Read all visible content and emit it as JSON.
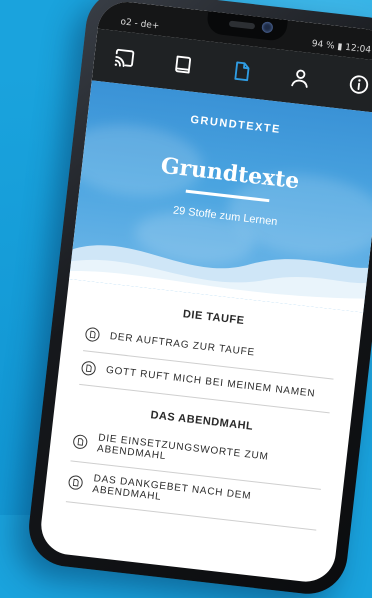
{
  "status_bar": {
    "carrier": "o2 - de+",
    "battery": "94 %",
    "time": "12:04"
  },
  "nav": {
    "items": [
      "cast-icon",
      "book-icon",
      "document-icon",
      "person-icon",
      "info-icon"
    ],
    "active_index": 2
  },
  "hero": {
    "kicker": "GRUNDTEXTE",
    "title": "Grundtexte",
    "subtitle": "29 Stoffe zum Lernen"
  },
  "sections": [
    {
      "heading": "DIE TAUFE",
      "items": [
        "DER AUFTRAG ZUR TAUFE",
        "GOTT RUFT MICH BEI MEINEM NAMEN"
      ]
    },
    {
      "heading": "DAS ABENDMAHL",
      "items": [
        "DIE EINSETZUNGSWORTE ZUM ABENDMAHL",
        "DAS DANKGEBET NACH DEM ABENDMAHL"
      ]
    }
  ],
  "colors": {
    "background": "#1aa3dd",
    "nav_bar": "#1f2224",
    "nav_icon": "#ffffff",
    "nav_icon_active": "#2f9de4",
    "hero_blue": "#3a92d6"
  }
}
